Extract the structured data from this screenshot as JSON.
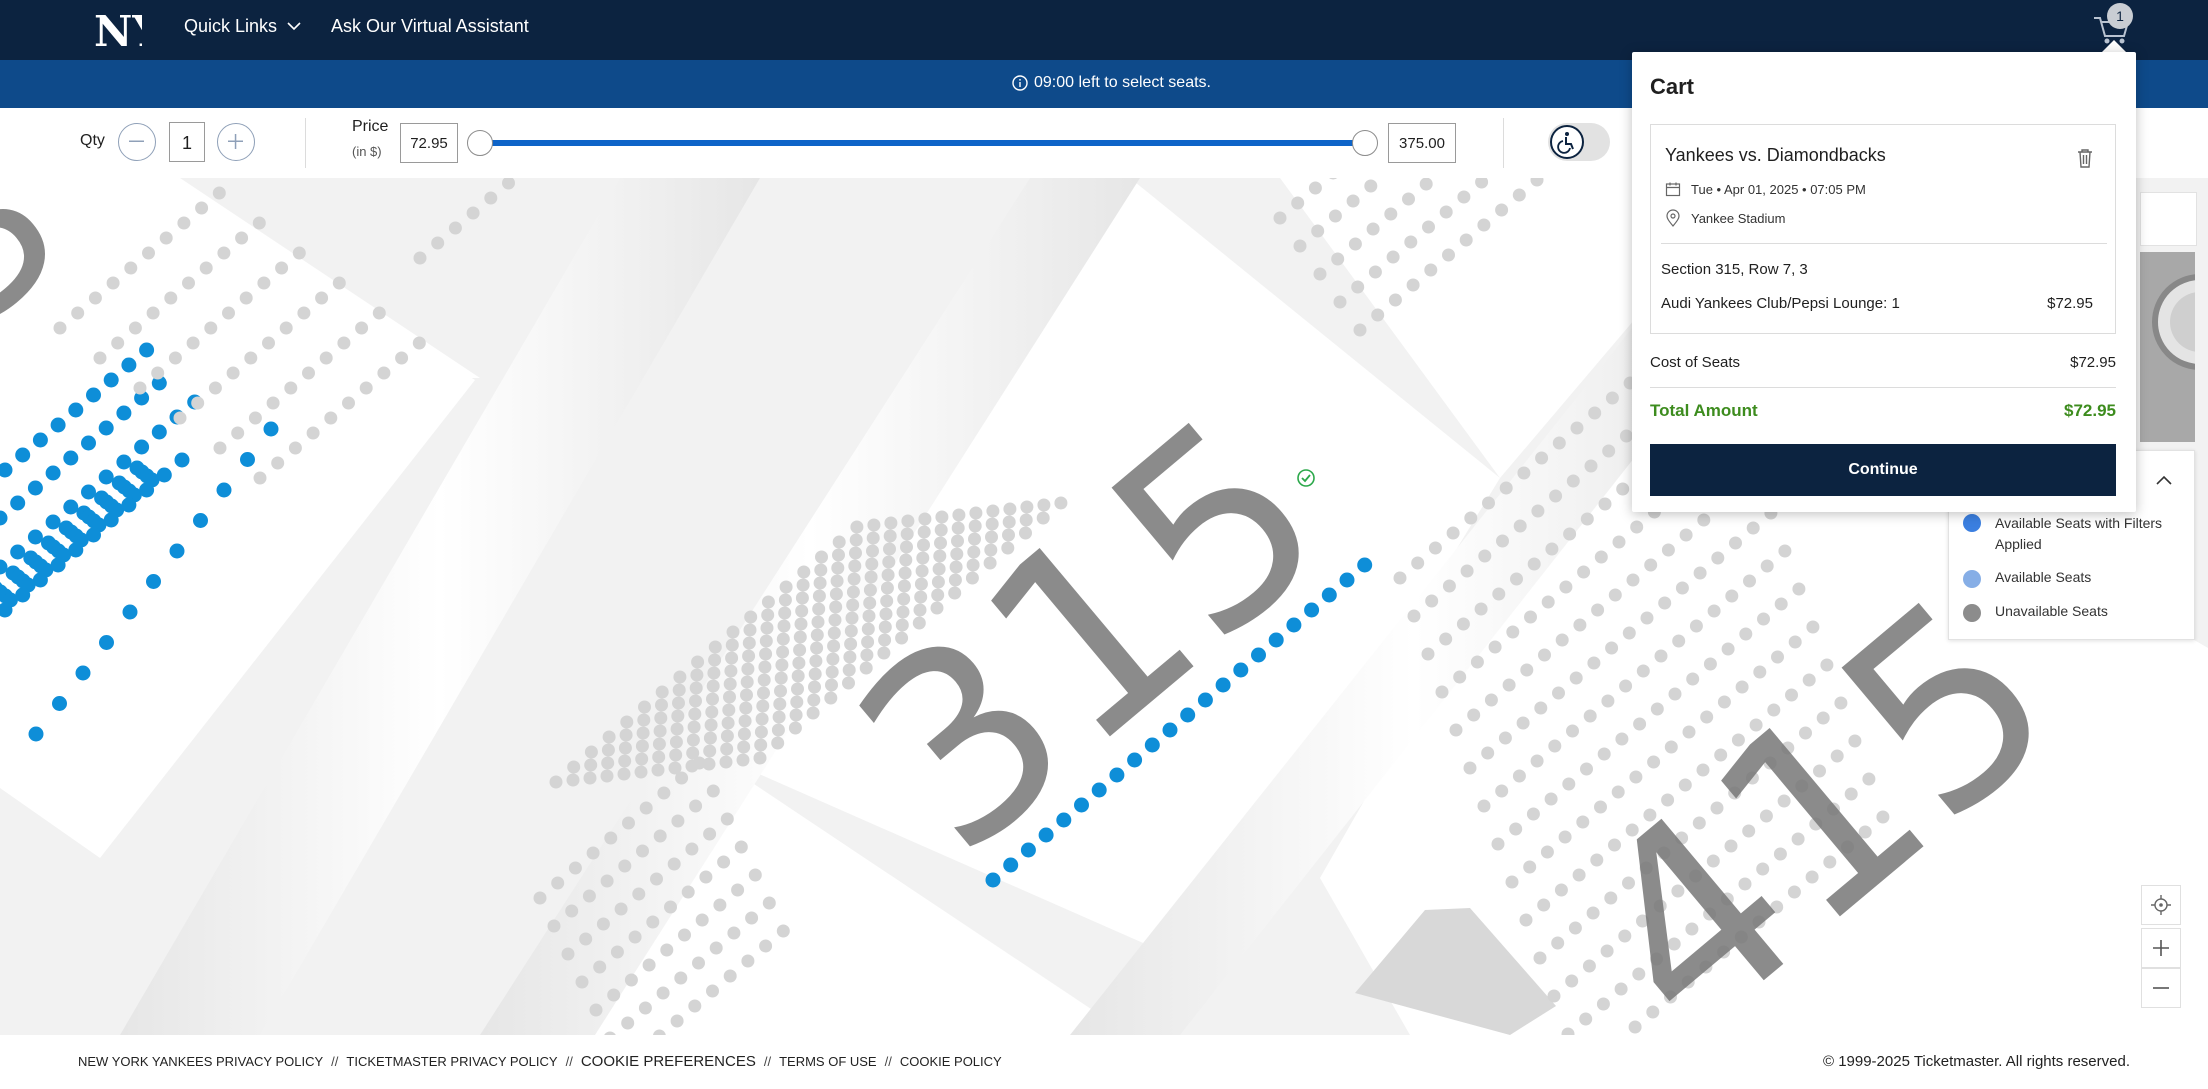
{
  "nav": {
    "quick_links": "Quick Links",
    "assistant": "Ask Our Virtual Assistant",
    "cart_count": "1"
  },
  "timer": {
    "text": "09:00 left to select seats."
  },
  "filters": {
    "qty_label": "Qty",
    "qty_value": "1",
    "price_label": "Price",
    "price_unit": "(in $)",
    "price_min": "72.95",
    "price_max": "375.00"
  },
  "map": {
    "sections": [
      "315",
      "415"
    ]
  },
  "legend": {
    "items": [
      {
        "label": "Available Seats with Filters Applied",
        "color": "#3b7fe0"
      },
      {
        "label": "Available Seats",
        "color": "#86aee6"
      },
      {
        "label": "Unavailable Seats",
        "color": "#8c8c8c"
      }
    ]
  },
  "cart": {
    "title": "Cart",
    "event_name": "Yankees vs. Diamondbacks",
    "date": "Tue • Apr 01, 2025 • 07:05 PM",
    "venue": "Yankee Stadium",
    "section": "Section 315, Row 7, 3",
    "ticket_type": "Audi Yankees Club/Pepsi Lounge: 1",
    "ticket_price": "$72.95",
    "cost_label": "Cost of Seats",
    "cost_value": "$72.95",
    "total_label": "Total Amount",
    "total_value": "$72.95",
    "continue_label": "Continue"
  },
  "footer": {
    "links": [
      "NEW YORK YANKEES PRIVACY POLICY",
      "TICKETMASTER PRIVACY POLICY",
      "COOKIE PREFERENCES",
      "TERMS OF USE",
      "COOKIE POLICY"
    ],
    "separator": "//",
    "copyright": "© 1999-2025 Ticketmaster. All rights reserved."
  },
  "colors": {
    "navy": "#0c2340",
    "seat_available": "#0e8ed8",
    "seat_unavailable": "#d4d4d4",
    "total_green": "#3d8c1e"
  }
}
